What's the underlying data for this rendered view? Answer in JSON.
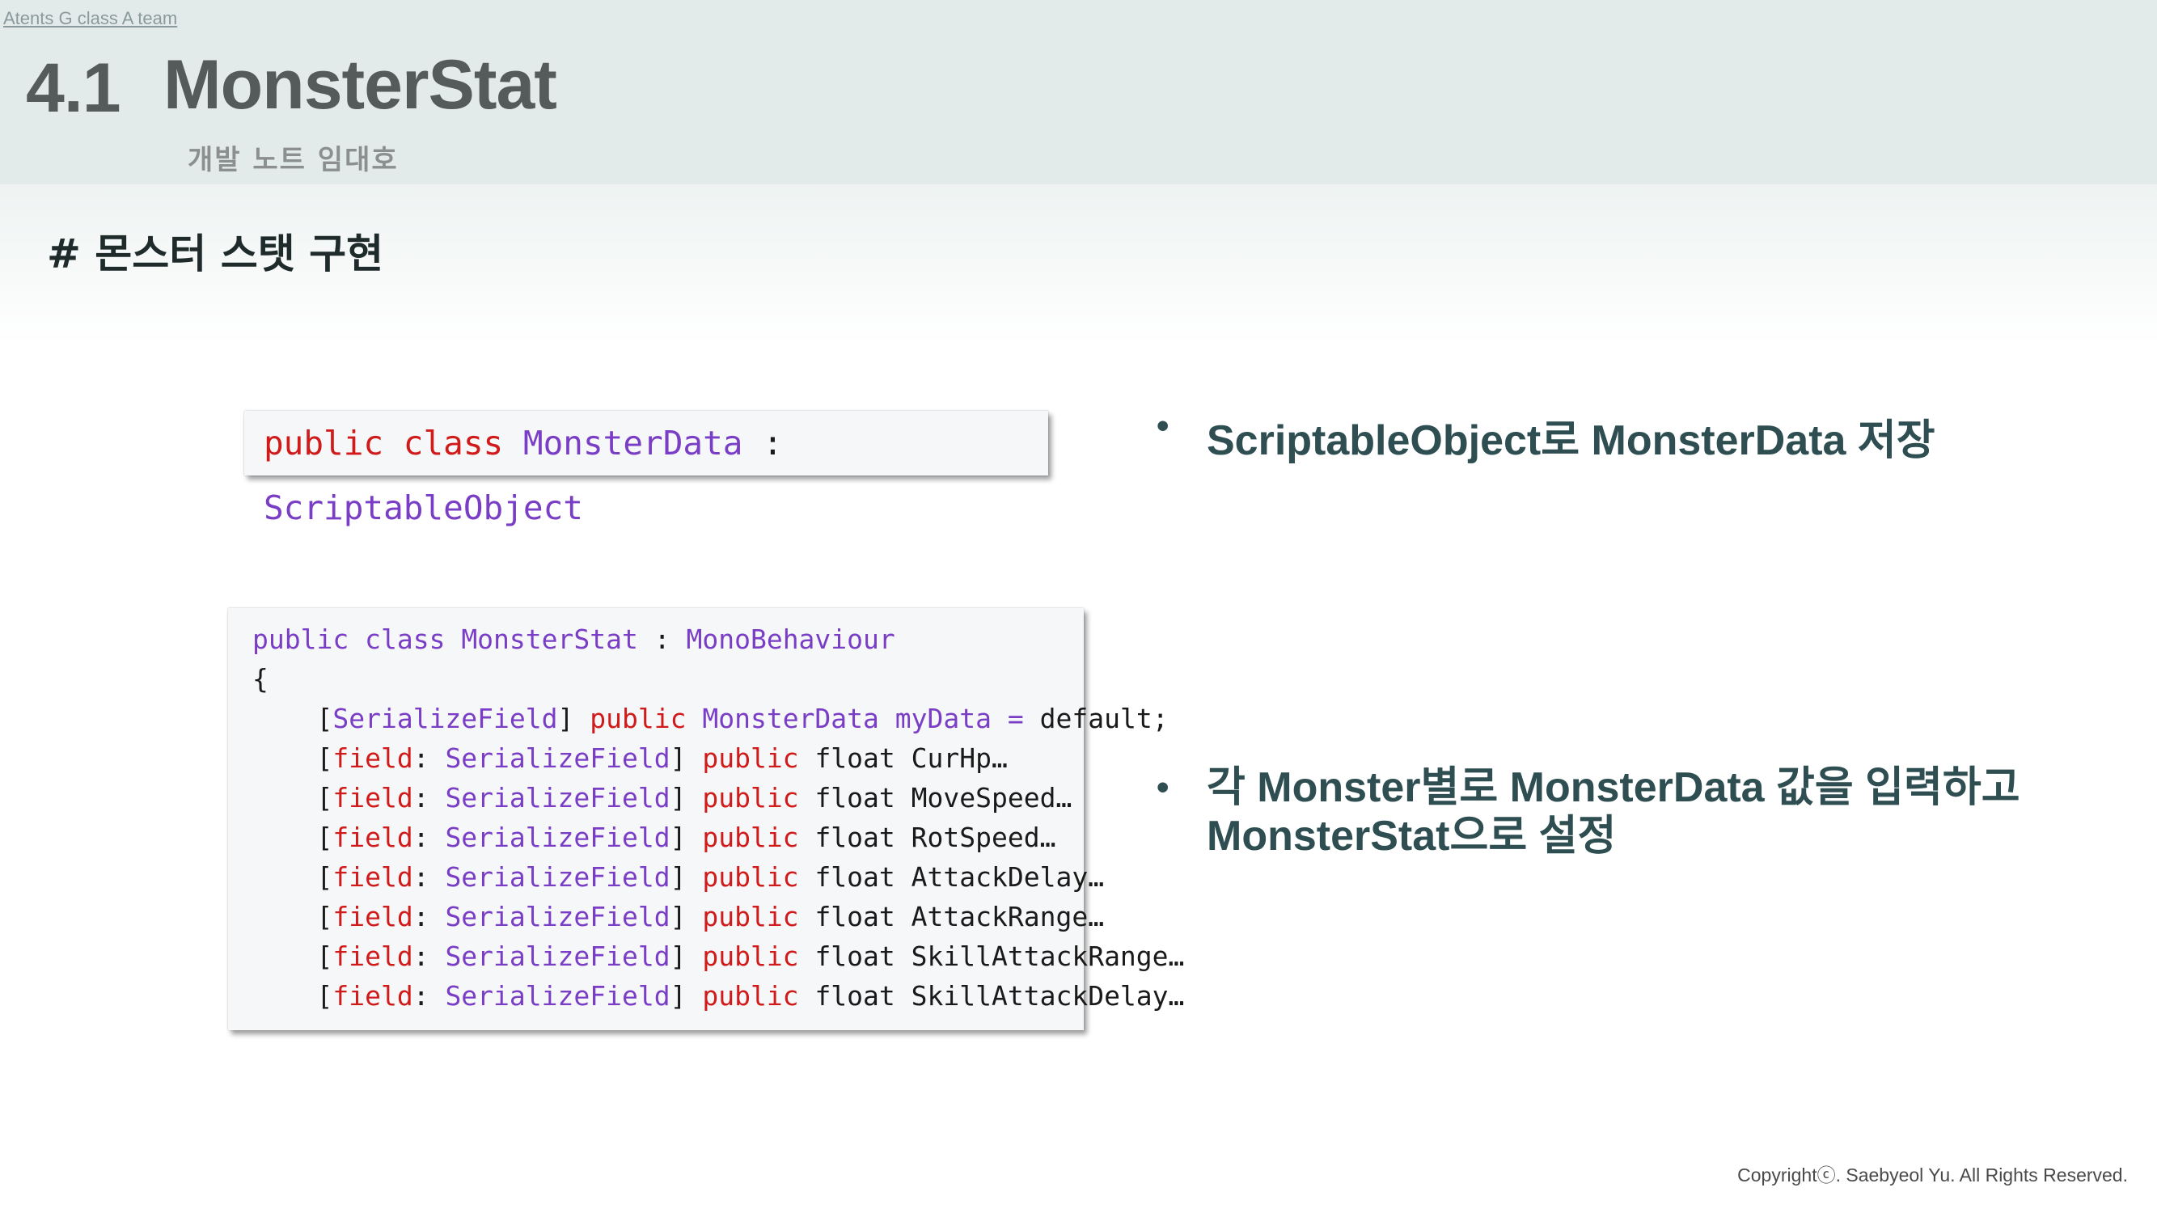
{
  "header": {
    "team_link": "Atents G class A team",
    "section_number": "4.1",
    "title": "MonsterStat",
    "subtitle": "개발 노트 임대호"
  },
  "section_heading": "# 몬스터 스탯 구현",
  "code_block_1": {
    "line": {
      "kw1": "public",
      "kw2": "class",
      "name": "MonsterData",
      "colon": ":",
      "base": "ScriptableObject"
    }
  },
  "code_block_2": {
    "header": {
      "kw1": "public",
      "kw2": "class",
      "name": "MonsterStat",
      "colon": ":",
      "base": "MonoBehaviour"
    },
    "open_brace": "{",
    "first_field": {
      "attr": "SerializeField",
      "kw": "public",
      "type": "MonsterData",
      "name": "myData",
      "eq": "=",
      "value": "default;"
    },
    "fields": [
      {
        "target": "field",
        "attr": "SerializeField",
        "kw": "public",
        "type": "float",
        "name": "CurHp…"
      },
      {
        "target": "field",
        "attr": "SerializeField",
        "kw": "public",
        "type": "float",
        "name": "MoveSpeed…"
      },
      {
        "target": "field",
        "attr": "SerializeField",
        "kw": "public",
        "type": "float",
        "name": "RotSpeed…"
      },
      {
        "target": "field",
        "attr": "SerializeField",
        "kw": "public",
        "type": "float",
        "name": "AttackDelay…"
      },
      {
        "target": "field",
        "attr": "SerializeField",
        "kw": "public",
        "type": "float",
        "name": "AttackRange…"
      },
      {
        "target": "field",
        "attr": "SerializeField",
        "kw": "public",
        "type": "float",
        "name": "SkillAttackRange…"
      },
      {
        "target": "field",
        "attr": "SerializeField",
        "kw": "public",
        "type": "float",
        "name": "SkillAttackDelay…"
      }
    ]
  },
  "bullets": {
    "bullet_char": "•",
    "first": "ScriptableObject로 MonsterData 저장",
    "second_line1": "각 Monster별로 MonsterData 값을 입력하고",
    "second_line2": "MonsterStat으로 설정"
  },
  "footer": {
    "copyright": "Copyrightⓒ. Saebyeol Yu. All Rights Reserved."
  },
  "colors": {
    "header_bg": "#e3ebea",
    "title_gray": "#555a5a",
    "bullet_teal": "#2e4e52",
    "code_keyword": "#d11a1a",
    "code_type": "#7a3ec6"
  }
}
